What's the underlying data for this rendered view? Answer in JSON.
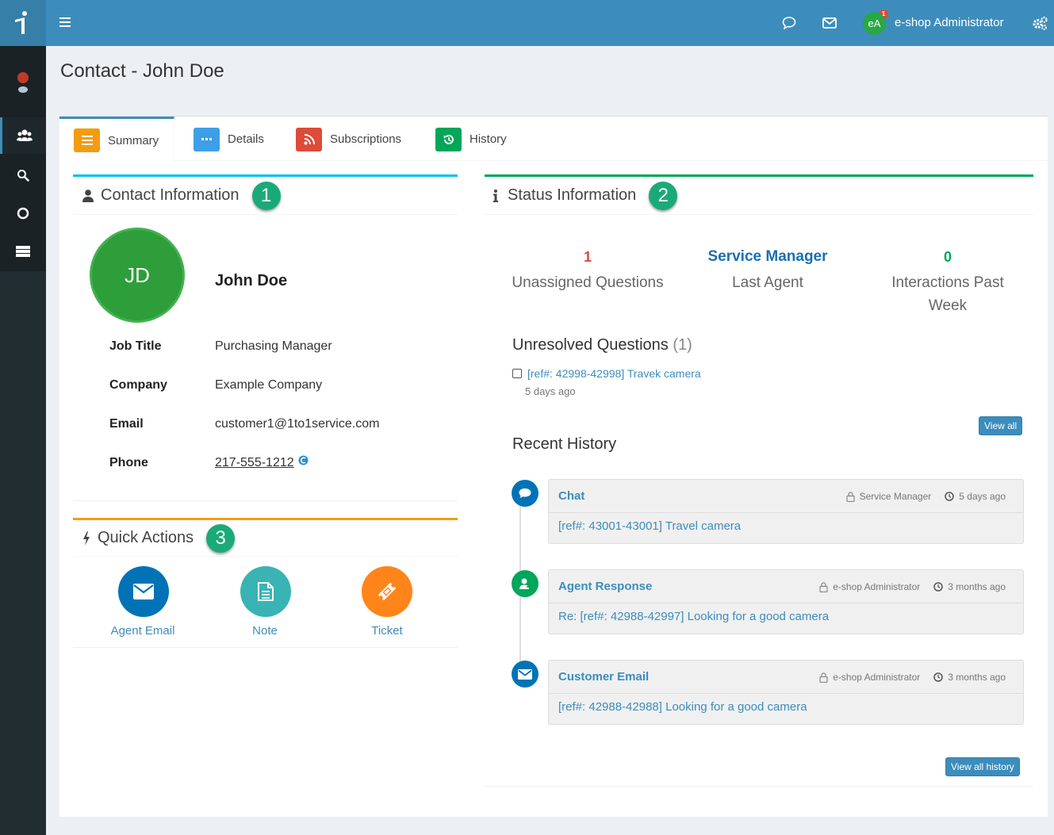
{
  "header": {
    "user_initials": "eA",
    "user_name": "e-shop Administrator",
    "notification_count": "1"
  },
  "page": {
    "title": "Contact - John Doe"
  },
  "tabs": [
    {
      "label": "Summary",
      "color": "#f39c12"
    },
    {
      "label": "Details",
      "color": "#3c8dbc"
    },
    {
      "label": "Subscriptions",
      "color": "#dd4b39"
    },
    {
      "label": "History",
      "color": "#00a65a"
    }
  ],
  "contact": {
    "section_title": "Contact Information",
    "marker": "1",
    "initials": "JD",
    "name": "John Doe",
    "fields": [
      {
        "label": "Job Title",
        "value": "Purchasing Manager"
      },
      {
        "label": "Company",
        "value": "Example Company"
      },
      {
        "label": "Email",
        "value": "customer1@1to1service.com"
      },
      {
        "label": "Phone",
        "value": "217-555-1212"
      }
    ]
  },
  "quick_actions": {
    "section_title": "Quick Actions",
    "marker": "3",
    "items": [
      {
        "label": "Agent Email",
        "color": "#0073b7"
      },
      {
        "label": "Note",
        "color": "#39b3b3"
      },
      {
        "label": "Ticket",
        "color": "#ff851b"
      }
    ]
  },
  "status": {
    "section_title": "Status Information",
    "marker": "2",
    "stats": [
      {
        "value": "1",
        "label": "Unassigned Questions",
        "color": "#dd4b39"
      },
      {
        "value": "Service Manager",
        "label": "Last Agent",
        "color": "#1a6fb0"
      },
      {
        "value": "0",
        "label": "Interactions Past Week",
        "color": "#00a65a"
      }
    ],
    "unresolved_title": "Unresolved Questions",
    "unresolved_count": "(1)",
    "unresolved_items": [
      {
        "label": "[ref#: 42998-42998] Travek camera",
        "time": "5 days ago"
      }
    ],
    "view_all_label": "View all",
    "recent_title": "Recent History",
    "history": [
      {
        "type": "Chat",
        "agent": "Service Manager",
        "time": "5 days ago",
        "subject": "[ref#: 43001-43001] Travel camera",
        "icon": "chat-icon",
        "color": "#0073b7"
      },
      {
        "type": "Agent Response",
        "agent": "e-shop Administrator",
        "time": "3 months ago",
        "subject": "Re: [ref#: 42988-42997] Looking for a good camera",
        "icon": "agent-response-icon",
        "color": "#00a65a"
      },
      {
        "type": "Customer Email",
        "agent": "e-shop Administrator",
        "time": "3 months ago",
        "subject": "[ref#: 42988-42988] Looking for a good camera",
        "icon": "envelope-icon",
        "color": "#0073b7"
      }
    ],
    "view_all_history_label": "View all history"
  }
}
